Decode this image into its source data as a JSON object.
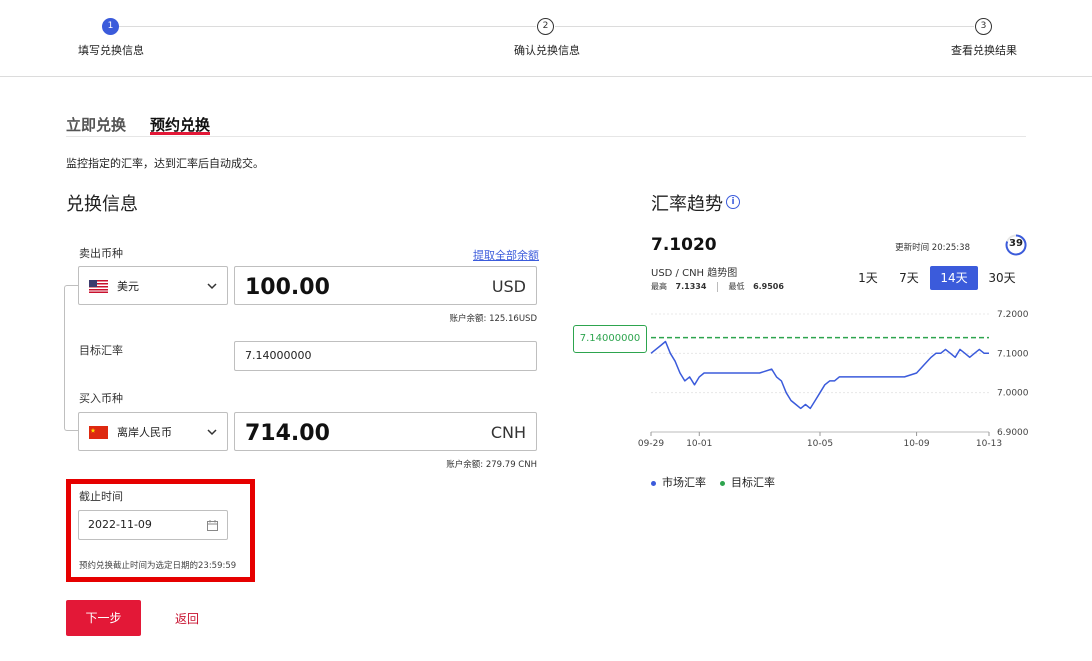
{
  "stepper": {
    "steps": [
      {
        "number": "1",
        "label": "填写兑换信息",
        "active": true
      },
      {
        "number": "2",
        "label": "确认兑换信息",
        "active": false
      },
      {
        "number": "3",
        "label": "查看兑换结果",
        "active": false
      }
    ]
  },
  "tabs": [
    {
      "label": "立即兑换",
      "active": false
    },
    {
      "label": "预约兑换",
      "active": true
    }
  ],
  "description": "监控指定的汇率，达到汇率后自动成交。",
  "form": {
    "title": "兑换信息",
    "sell_label": "卖出币种",
    "withdraw_all": "提取全部余额",
    "sell_currency": "美元",
    "sell_amount": "100.00",
    "sell_code": "USD",
    "sell_balance": "账户余额: 125.16USD",
    "target_rate_label": "目标汇率",
    "target_rate_value": "7.14000000",
    "buy_label": "买入币种",
    "buy_currency": "离岸人民币",
    "buy_amount": "714.00",
    "buy_code": "CNH",
    "buy_balance": "账户余额: 279.79 CNH",
    "deadline_label": "截止时间",
    "deadline_value": "2022-11-09",
    "deadline_hint": "预约兑换截止时间为选定日期的23:59:59",
    "next_button": "下一步",
    "back_link": "返回"
  },
  "trend": {
    "title": "汇率趋势",
    "rate": "7.1020",
    "pair": "USD / CNH  趋势图",
    "high_label": "最高",
    "high_value": "7.1334",
    "low_label": "最低",
    "low_value": "6.9506",
    "update_time": "更新时间 20:25:38",
    "countdown": "39",
    "ranges": [
      {
        "label": "1天",
        "active": false
      },
      {
        "label": "7天",
        "active": false
      },
      {
        "label": "14天",
        "active": true
      },
      {
        "label": "30天",
        "active": false
      }
    ],
    "legend_market": "市场汇率",
    "legend_target": "目标汇率",
    "target_tag": "7.14000000"
  },
  "colors": {
    "primary_blue": "#3b5bdb",
    "brand_red": "#e31837",
    "target_green": "#2da44e",
    "highlight_red": "#e60000"
  },
  "chart_data": {
    "type": "line",
    "x_ticks": [
      "09-29",
      "10-01",
      "10-05",
      "10-09",
      "10-13"
    ],
    "y_ticks": [
      "7.2000",
      "7.1000",
      "7.0000",
      "6.9000"
    ],
    "ylim": [
      6.9,
      7.2
    ],
    "target": 7.14,
    "series": [
      {
        "name": "市场汇率",
        "x": [
          0,
          0.2,
          0.4,
          0.6,
          0.8,
          1.0,
          1.2,
          1.4,
          1.6,
          1.8,
          2.0,
          2.2,
          2.5,
          3.0,
          3.5,
          4.0,
          4.5,
          5.0,
          5.2,
          5.4,
          5.6,
          5.8,
          6.0,
          6.2,
          6.4,
          6.6,
          6.8,
          7.0,
          7.2,
          7.4,
          7.6,
          7.8,
          8.0,
          8.2,
          8.5,
          9.0,
          9.5,
          10.0,
          10.5,
          11.0,
          11.3,
          11.6,
          11.8,
          12.0,
          12.2,
          12.4,
          12.6,
          12.8,
          13.0,
          13.2,
          13.4,
          13.6,
          13.8,
          14.0
        ],
        "values": [
          7.1,
          7.11,
          7.12,
          7.13,
          7.1,
          7.08,
          7.05,
          7.03,
          7.04,
          7.02,
          7.04,
          7.05,
          7.05,
          7.05,
          7.05,
          7.05,
          7.05,
          7.06,
          7.04,
          7.03,
          7.0,
          6.98,
          6.97,
          6.96,
          6.97,
          6.96,
          6.98,
          7.0,
          7.02,
          7.03,
          7.03,
          7.04,
          7.04,
          7.04,
          7.04,
          7.04,
          7.04,
          7.04,
          7.04,
          7.05,
          7.07,
          7.09,
          7.1,
          7.1,
          7.11,
          7.1,
          7.09,
          7.11,
          7.1,
          7.09,
          7.1,
          7.11,
          7.1,
          7.1
        ]
      },
      {
        "name": "目标汇率",
        "constant": 7.14
      }
    ]
  }
}
